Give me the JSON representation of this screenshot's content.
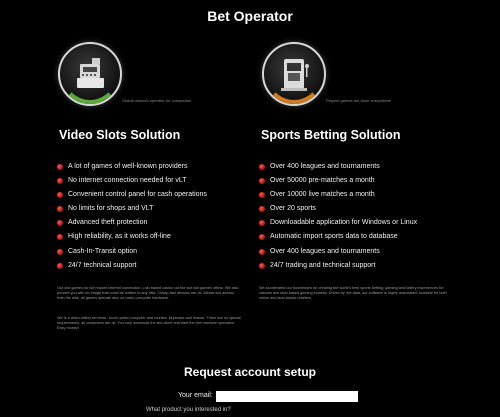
{
  "page": {
    "title": "Bet Operator"
  },
  "hero": {
    "left": {
      "icon": "cash-register-icon",
      "accent": "#5aa93a",
      "caption": "Global network operator for companies"
    },
    "right": {
      "icon": "casino-slot-icon",
      "accent": "#d07b1d",
      "caption": "Players games are done everywhere"
    }
  },
  "video_slots": {
    "title": "Video Slots Solution",
    "features": [
      "A lot of games of well-known providers",
      "No internet connection needed for vLT",
      "Convenient control panel for cash operations",
      "No limits for shops and VLT",
      "Advanced theft protection",
      "High reliability, as it works off-line",
      "Cash-In-Transit option",
      "24/7 technical support"
    ],
    "description_1": "Our slot games do not require internet connection. Lost based casino via the slot slot games offline. We also provide you with an image that could be written to any disk. Cheap fast devices are ok. Allows slot access from the disk, all games operate also on basic computer hardware.",
    "description_2": "We is a video lottery terminal - touch-panel computer and monitor, keyboard and mouse. There are no special requirements, all computers are ok. You only download the slot client and start the slot machine operation. Easy money!"
  },
  "sports_betting": {
    "title": "Sports Betting Solution",
    "features": [
      "Over 400 leagues and tournaments",
      "Over 50000 pre-matches a month",
      "Over 10000 live matches a month",
      "Over 20 sports",
      "Downloadable application for Windows or Linux",
      "Automatic import sports data to database",
      "Over 400 leagues and tournaments",
      "24/7 trading and technical support"
    ],
    "description_1": "We accelerated our businesses for creating the world's best sports betting, gaming and lottery experiences for casinos and land-based gaming industry. Driven by live data, our software is highly automated, scalable for both online and land-based retailers."
  },
  "request": {
    "title": "Request account setup",
    "email_label": "Your email:",
    "email_value": "",
    "question": "What product you interested in?"
  },
  "colors": {
    "background": "#000000",
    "bullet": "#d41a1a",
    "text": "#ffffff"
  }
}
